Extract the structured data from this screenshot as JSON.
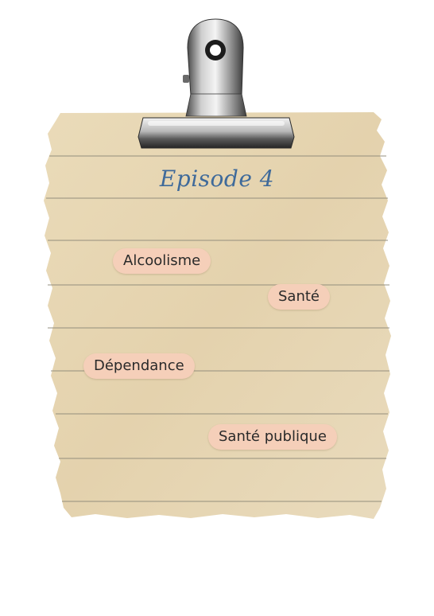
{
  "episode": {
    "title": "Episode 4"
  },
  "tags": [
    {
      "label": "Alcoolisme"
    },
    {
      "label": "Santé"
    },
    {
      "label": "Dépendance"
    },
    {
      "label": "Santé publique"
    }
  ],
  "colors": {
    "paper": "#e7d6b3",
    "lines": "#8f8a7a",
    "tag_background": "#f5cfb9",
    "title_ink": "#3f6a9a"
  },
  "icons": {
    "clip": "binder-clip-icon"
  }
}
